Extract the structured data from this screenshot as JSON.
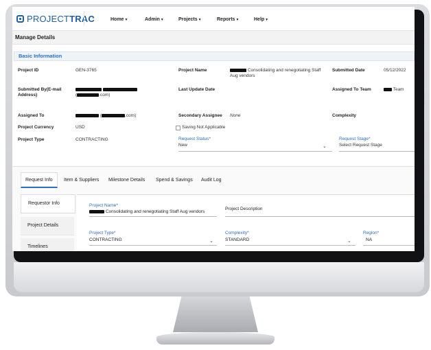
{
  "app": {
    "logo_text_light": "PROJECT",
    "logo_text_bold": "TRAC"
  },
  "nav": [
    {
      "label": "Home"
    },
    {
      "label": "Admin"
    },
    {
      "label": "Projects"
    },
    {
      "label": "Reports"
    },
    {
      "label": "Help"
    }
  ],
  "page_title": "Manage Details",
  "basic_info": {
    "section_label": "Basic Information",
    "project_id_label": "Project ID",
    "project_id_value": "GEN-3765",
    "project_name_label": "Project Name",
    "project_name_value_line1": "Consolidating and renegotiating Staff",
    "project_name_value_line2": "Aug vendors",
    "submitted_date_label": "Submitted Date",
    "submitted_date_value": "05/12/2022",
    "submitted_by_label_line1": "Submitted By(E-mail",
    "submitted_by_label_line2": "Address)",
    "submitted_by_email_suffix": ".com)",
    "last_update_label": "Last Update Date",
    "assigned_team_label": "Assigned To Team",
    "assigned_team_value": "Team",
    "assigned_to_label": "Assigned To",
    "assigned_to_email_suffix": ".com)",
    "secondary_assignee_label": "Secondary Assignee",
    "secondary_assignee_value": "None",
    "complexity_label": "Complexity",
    "currency_label": "Project Currency",
    "currency_value": "USD",
    "saving_na_label": "Saving Not Applicable",
    "project_type_label": "Project Type",
    "project_type_value": "CONTRACTING",
    "request_status_label": "Request Status",
    "request_status_value": "New",
    "request_stage_label": "Request Stage",
    "request_stage_value": "Select Request Stage",
    "required_mark": "*"
  },
  "tabs": [
    {
      "label": "Request Info"
    },
    {
      "label": "Item & Suppliers"
    },
    {
      "label": "Milestone Details"
    },
    {
      "label": "Spend & Savings"
    },
    {
      "label": "Audit Log"
    }
  ],
  "side_items": [
    {
      "label": "Requestor Info"
    },
    {
      "label": "Project Details"
    },
    {
      "label": "Timelines"
    }
  ],
  "form": {
    "project_name_label": "Project Name",
    "project_name_value": "Consolidating and renegotiating Staff Aug vendors",
    "project_description_label": "Project Description",
    "project_type_label": "Project Type",
    "project_type_value": "CONTRACTING",
    "complexity_label": "Complexity",
    "complexity_value": "STANDARD",
    "region_label": "Region",
    "region_value": "NA"
  },
  "colors": {
    "accent": "#2a6fbf",
    "brand": "#1f5ea8"
  }
}
